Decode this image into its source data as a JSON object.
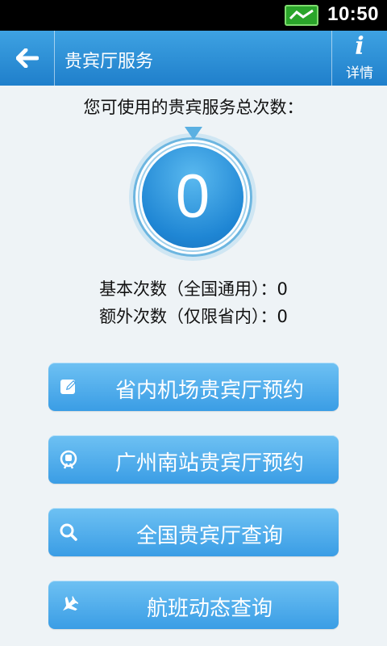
{
  "status_bar": {
    "time": "10:50"
  },
  "header": {
    "title": "贵宾厅服务",
    "detail_label": "详情",
    "detail_glyph": "i"
  },
  "summary": {
    "question": "您可使用的贵宾服务总次数：",
    "total_count": "0",
    "basic_line": "基本次数（全国通用）：0",
    "extra_line": "额外次数（仅限省内）：0"
  },
  "actions": [
    {
      "label": "省内机场贵宾厅预约",
      "icon": "edit-icon"
    },
    {
      "label": "广州南站贵宾厅预约",
      "icon": "train-icon"
    },
    {
      "label": "全国贵宾厅查询",
      "icon": "search-icon"
    },
    {
      "label": "航班动态查询",
      "icon": "airplane-icon"
    }
  ],
  "colors": {
    "header": "#2a8fd6",
    "button": "#4aa9ea",
    "accent_circle": "#1f86d4"
  }
}
